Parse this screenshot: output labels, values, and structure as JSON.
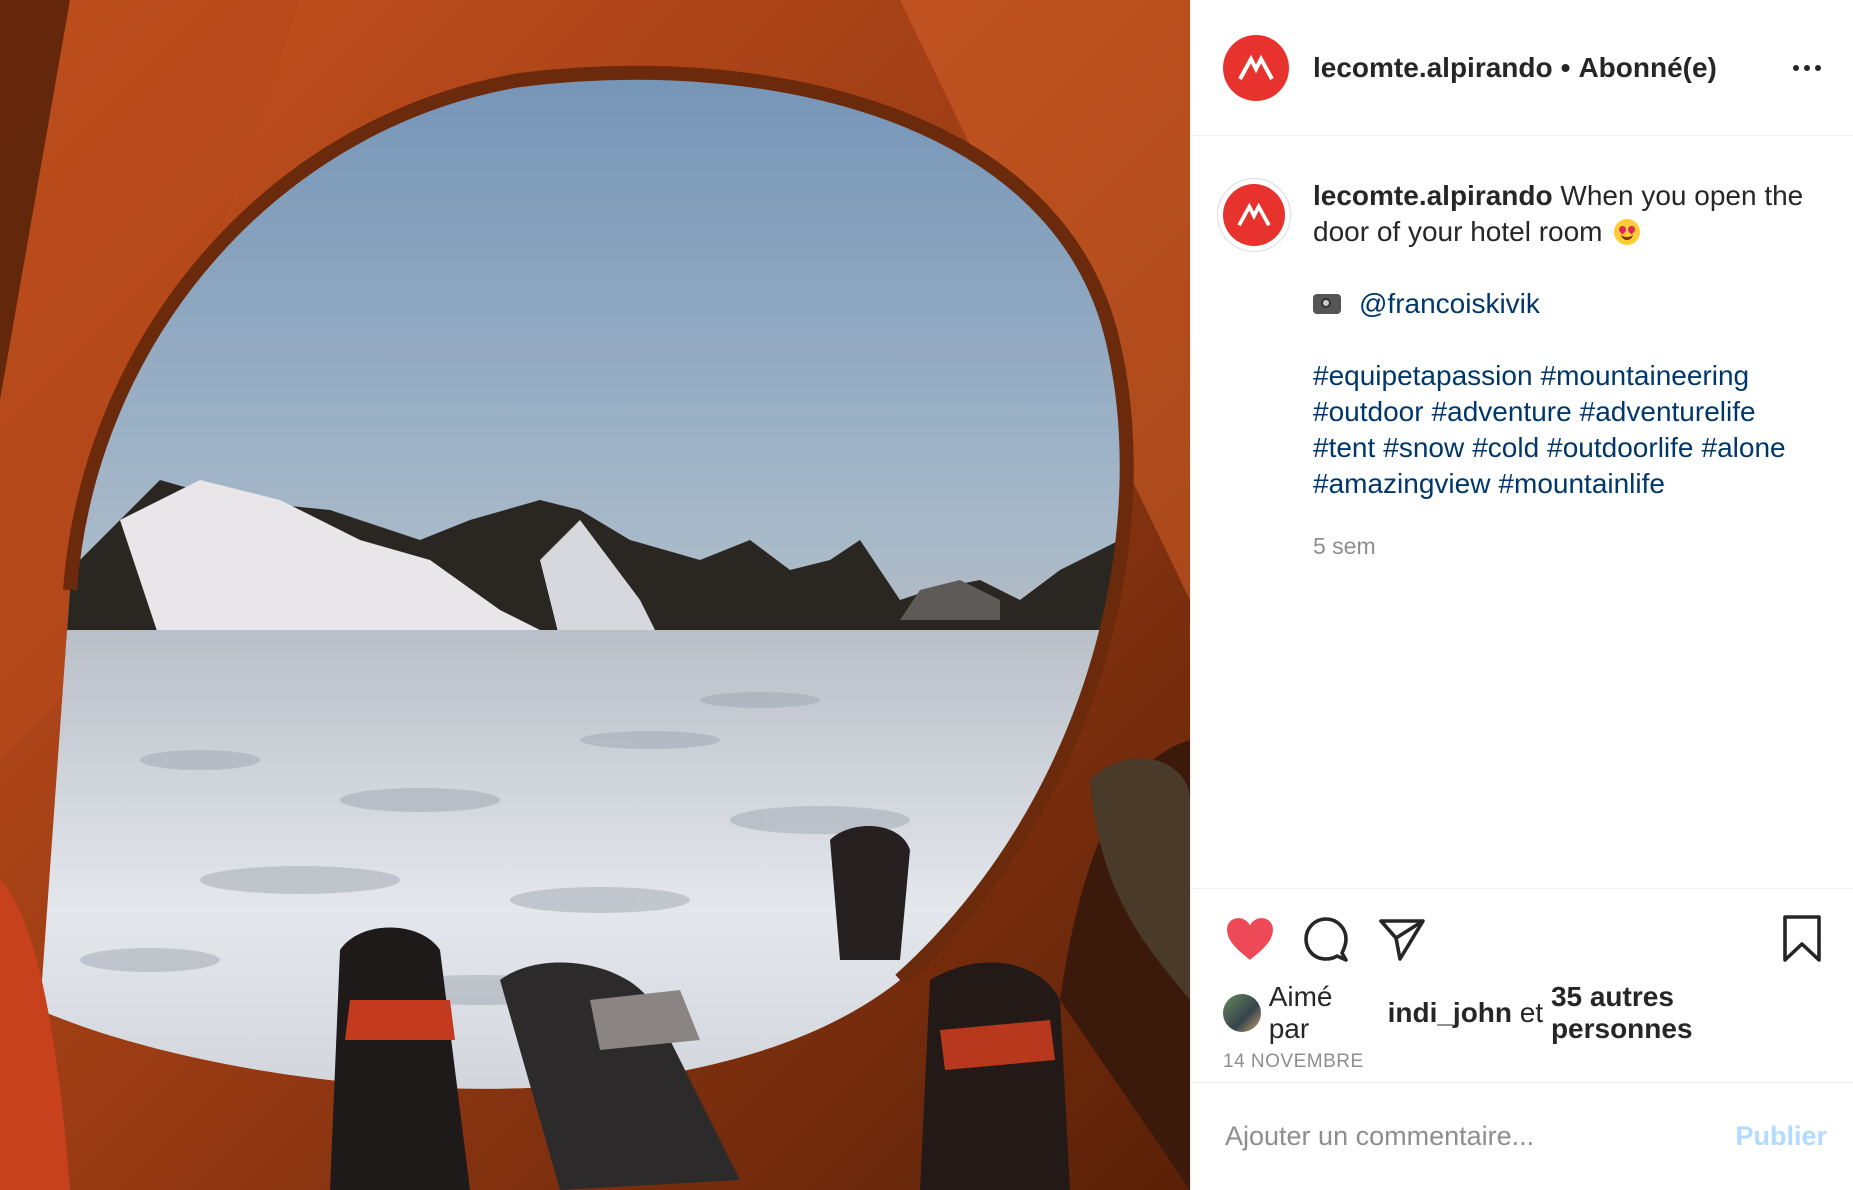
{
  "post": {
    "username": "lecomte.alpirando",
    "separator": "•",
    "follow_status": "Abonné(e)",
    "caption_text": "When you open the door of your hotel room",
    "caption_emoji": "heart-eyes-emoji",
    "credit_icon": "camera-icon",
    "credit_handle": "@francoiskivik",
    "hashtags": [
      [
        "#equipetapassion",
        "#mountaineering"
      ],
      [
        "#outdoor",
        "#adventure",
        "#adventurelife"
      ],
      [
        "#tent",
        "#snow",
        "#cold",
        "#outdoorlife",
        "#alone"
      ],
      [
        "#amazingview",
        "#mountainlife"
      ]
    ],
    "caption_time": "5 sem",
    "liked_prefix": "Aimé par",
    "liked_user": "indi_john",
    "liked_and": "et",
    "liked_others": "35 autres personnes",
    "date": "14 NOVEMBRE"
  },
  "actions": {
    "like_icon": "heart-icon",
    "like_state": "liked",
    "comment_icon": "comment-icon",
    "share_icon": "send-icon",
    "save_icon": "bookmark-icon"
  },
  "comment_box": {
    "placeholder": "Ajouter un commentaire...",
    "publish_label": "Publier"
  },
  "colors": {
    "brand_red": "#e8322d",
    "like_red": "#ed4956",
    "link_blue": "#00376b",
    "publish_disabled": "#b3dbff"
  }
}
